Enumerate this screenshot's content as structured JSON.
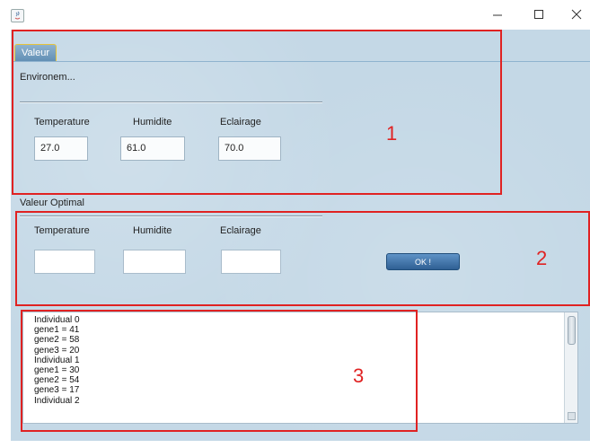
{
  "window": {
    "buttons": [
      "minimize",
      "maximize",
      "close"
    ]
  },
  "tab": {
    "label": "Valeur"
  },
  "environment": {
    "heading": "Environem...",
    "temperature_label": "Temperature",
    "humidite_label": "Humidite",
    "eclairage_label": "Eclairage",
    "temperature_value": "27.0",
    "humidite_value": "61.0",
    "eclairage_value": "70.0"
  },
  "optimal": {
    "heading": "Valeur Optimal",
    "temperature_label": "Temperature",
    "humidite_label": "Humidite",
    "eclairage_label": "Eclairage",
    "temperature_value": "",
    "humidite_value": "",
    "eclairage_value": "",
    "ok_label": "OK !"
  },
  "output": {
    "lines": [
      "Individual 0",
      "gene1 = 41",
      "gene2 = 58",
      "gene3 = 20",
      "Individual 1",
      "gene1 = 30",
      "gene2 = 54",
      "gene3 = 17",
      "Individual 2"
    ]
  },
  "annotations": {
    "box1": "1",
    "box2": "2",
    "box3": "3",
    "color": "#e02222"
  }
}
